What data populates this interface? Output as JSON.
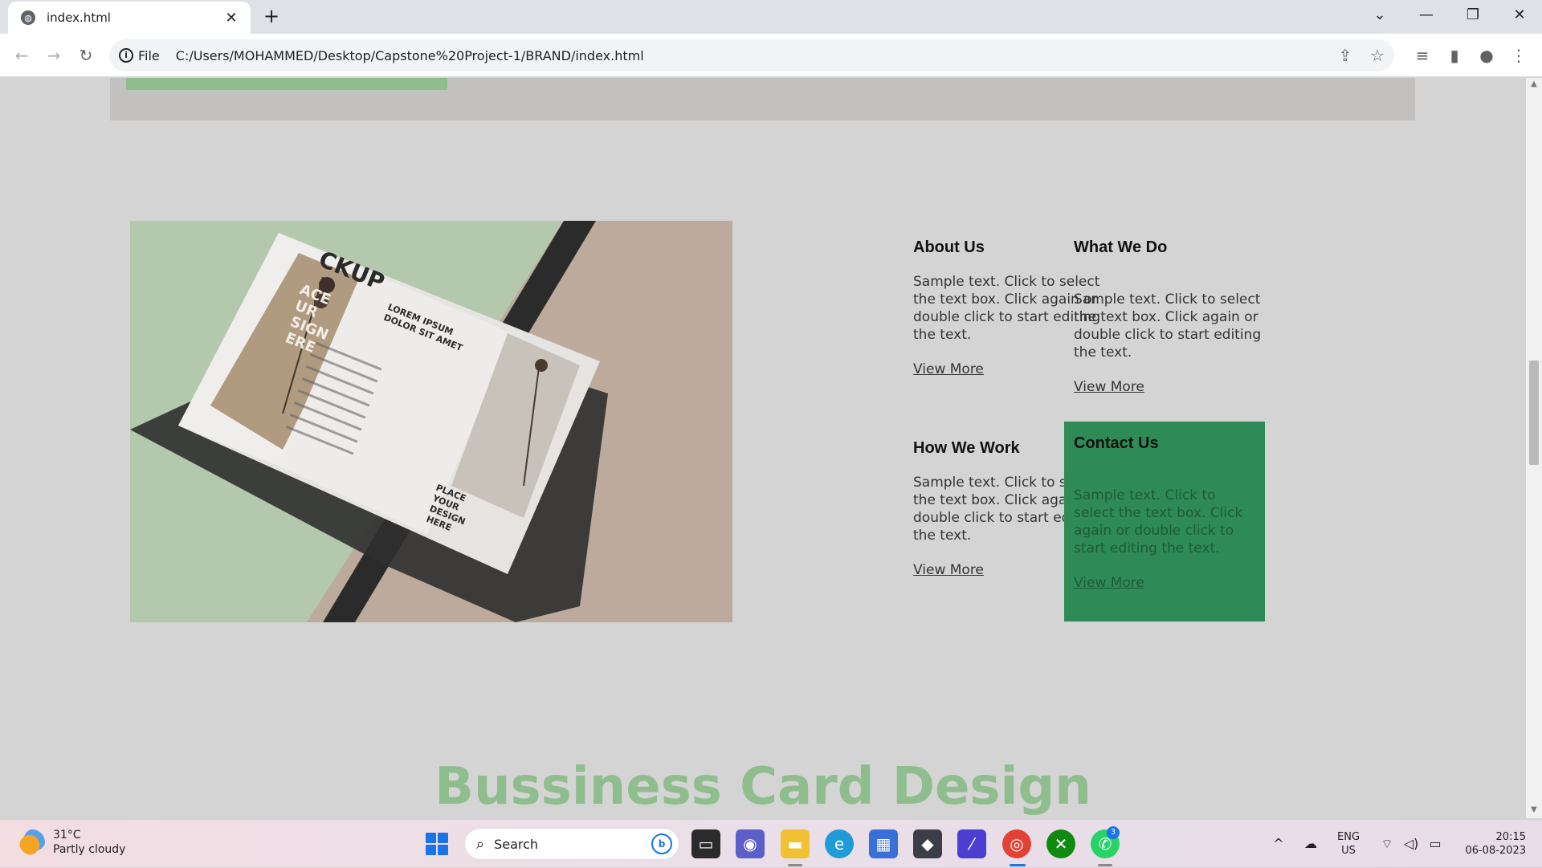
{
  "browser": {
    "tab_title": "index.html",
    "address_scheme": "File",
    "address_url": "C:/Users/MOHAMMED/Desktop/Capstone%20Project-1/BRAND/index.html"
  },
  "page": {
    "info_blocks": [
      {
        "title": "About Us",
        "text": "Sample text. Click to select the text box. Click again or double click to start editing the text.",
        "link": "View More"
      },
      {
        "title": "What We Do",
        "text": "Sample text. Click to select the text box. Click again or double click to start editing the text.",
        "link": "View More"
      },
      {
        "title": "How We Work",
        "text": "Sample text. Click to select the text box. Click again or double click to start editing the text.",
        "link": "View More"
      },
      {
        "title": "Contact Us",
        "text": "Sample text. Click to select the text box. Click again or double click to start editing the text.",
        "link": "View More"
      }
    ],
    "brochure_text": {
      "mockup": "CKUP",
      "side": "ACE\nUR\nSIGN\nERE",
      "lorem": "LOREM IPSUM\nDOLOR SIT AMET",
      "place": "PLACE\nYOUR\nDESIGN\nHERE"
    },
    "section_title": "Bussiness Card Design",
    "colors": {
      "accent_green": "#8fbd8e",
      "contact_green": "#2e8b57",
      "page_bg": "#d4d4d4"
    }
  },
  "taskbar": {
    "weather_temp": "31°C",
    "weather_condition": "Partly cloudy",
    "search_placeholder": "Search",
    "language": "ENG",
    "region": "US",
    "time": "20:15",
    "date": "06-08-2023",
    "whatsapp_badge": "3"
  }
}
